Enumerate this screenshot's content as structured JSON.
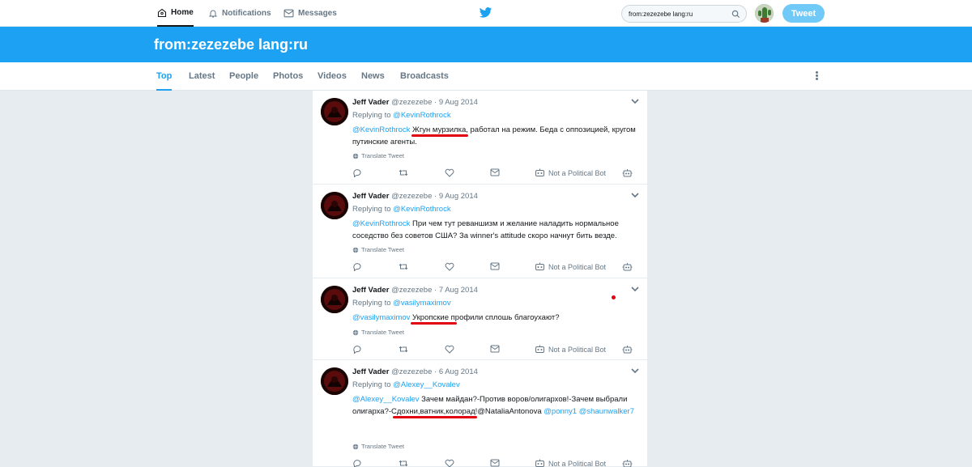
{
  "nav": {
    "home": "Home",
    "notifications": "Notifications",
    "messages": "Messages"
  },
  "search": {
    "value": "from:zezezebe lang:ru"
  },
  "tweet_button": "Tweet",
  "header": {
    "query": "from:zezezebe lang:ru"
  },
  "tabs": [
    "Top",
    "Latest",
    "People",
    "Photos",
    "Videos",
    "News",
    "Broadcasts"
  ],
  "active_tab": "Top",
  "colors": {
    "brand_blue": "#1da1f2",
    "annotation_red": "#e0000f",
    "muted": "#657786"
  },
  "tweets": [
    {
      "name": "Jeff Vader",
      "handle": "@zezezebe",
      "date": "· 9 Aug 2014",
      "replying_label": "Replying to",
      "replying_to": "@KevinRothrock",
      "mention": "@KevinRothrock",
      "text": " Жгун мурзилка, работал на режим. Беда с оппозицией, кругом путинские агенты.",
      "translate": "Translate Tweet",
      "bot_label": "Not a Political Bot"
    },
    {
      "name": "Jeff Vader",
      "handle": "@zezezebe",
      "date": "· 9 Aug 2014",
      "replying_label": "Replying to",
      "replying_to": "@KevinRothrock",
      "mention": "@KevinRothrock",
      "text": " При чем тут реваншизм и желание наладить нормальное соседство без советов США? За winner's attitude скоро начнут бить везде.",
      "translate": "Translate Tweet",
      "bot_label": "Not a Political Bot"
    },
    {
      "name": "Jeff Vader",
      "handle": "@zezezebe",
      "date": "· 7 Aug 2014",
      "replying_label": "Replying to",
      "replying_to": "@vasilymaximov",
      "mention": "@vasilymaximov",
      "text": " Укропские профили сплошь благоухают?",
      "translate": "Translate Tweet",
      "bot_label": "Not a Political Bot"
    },
    {
      "name": "Jeff Vader",
      "handle": "@zezezebe",
      "date": "· 6 Aug 2014",
      "replying_label": "Replying to",
      "replying_to": "@Alexey__Kovalev",
      "mention": "@Alexey__Kovalev",
      "text": " Зачем майдан?-Против воров/олигархов!-Зачем выбрали олигарха?-Сдохни,ватник,колорад!",
      "mention2": "@NataliaAntonova",
      "mention3": "@ponny1",
      "mention4": "@shaunwalker7",
      "translate": "Translate Tweet",
      "bot_label": "Not a Political Bot"
    }
  ]
}
